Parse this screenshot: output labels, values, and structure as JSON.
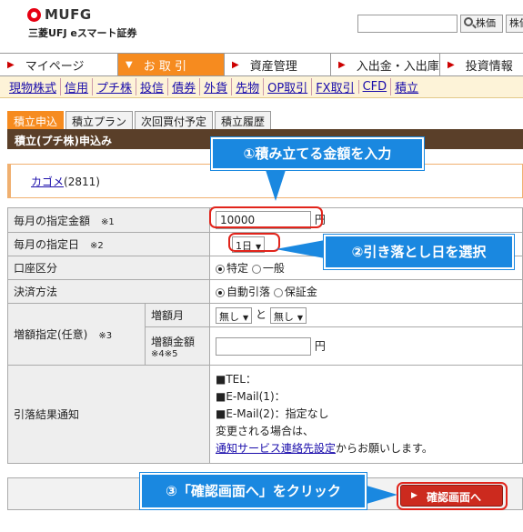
{
  "header": {
    "logo": "MUFG",
    "subtitle": "三菱UFJ eスマート証券",
    "search_placeholder": "",
    "search_btn": "株価",
    "search_btn2": "株価"
  },
  "nav": [
    {
      "label": "マイページ"
    },
    {
      "label": "お 取 引"
    },
    {
      "label": "資産管理"
    },
    {
      "label": "入出金・入出庫"
    },
    {
      "label": "投資情報"
    }
  ],
  "subnav": [
    "現物株式",
    "信用",
    "プチ株",
    "投信",
    "債券",
    "外貨",
    "先物",
    "OP取引",
    "FX取引",
    "CFD",
    "積立"
  ],
  "tabs": [
    "積立申込",
    "積立プラン",
    "次回買付予定",
    "積立履歴"
  ],
  "section_title": "積立(プチ株)申込み",
  "stock": {
    "name": "カゴメ",
    "code": "(2811)"
  },
  "form": {
    "amount_label": "毎月の指定金額",
    "amount_note": "※1",
    "amount_value": "10000",
    "amount_unit": "円",
    "day_label": "毎月の指定日",
    "day_note": "※2",
    "day_value": "1日",
    "account_label": "口座区分",
    "account_opt1": "特定",
    "account_opt2": "一般",
    "payment_label": "決済方法",
    "payment_opt1": "自動引落",
    "payment_opt2": "保証金",
    "increase_label": "増額指定(任意)",
    "increase_note": "※3",
    "inc_month_label": "増額月",
    "inc_month_sel1": "無し",
    "inc_month_and": "と",
    "inc_month_sel2": "無し",
    "inc_amount_label": "増額金額",
    "inc_amount_note": "※4※5",
    "inc_amount_unit": "円",
    "notify_label": "引落結果通知",
    "notify_tel": "■TEL：",
    "notify_mail1": "■E-Mail(1)：",
    "notify_mail2": "■E-Mail(2)：指定なし",
    "notify_change": "変更される場合は、",
    "notify_link": "通知サービス連絡先設定",
    "notify_tail": "からお願いします。"
  },
  "confirm_btn": "確認画面へ",
  "callouts": {
    "c1": "①積み立てる金額を入力",
    "c2": "②引き落とし日を選択",
    "c3": "③「確認画面へ」をクリック"
  }
}
